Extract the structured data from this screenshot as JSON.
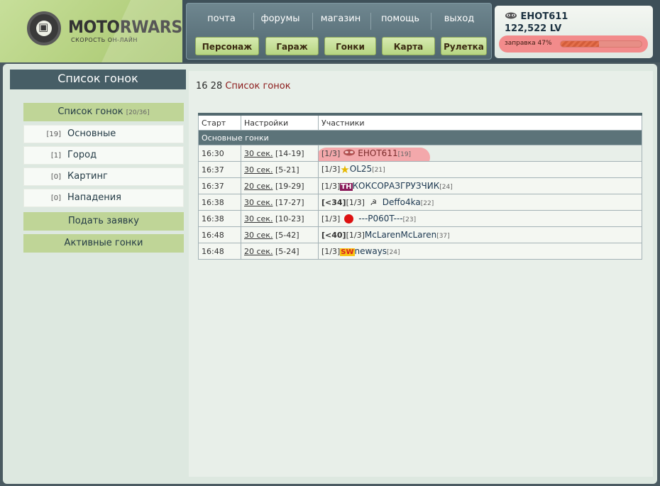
{
  "brand": {
    "title": "MOTORWARS.RU",
    "subtitle": "СКОРОСТЬ ОН-ЛАЙН"
  },
  "nav": {
    "top": [
      "почта",
      "форумы",
      "магазин",
      "помощь",
      "выход"
    ],
    "buttons": [
      "Персонаж",
      "Гараж",
      "Гонки",
      "Карта",
      "Рулетка"
    ]
  },
  "user": {
    "name": "ЕНОТ611",
    "money": "122,522 LV",
    "fuel_label": "заправка 47%",
    "fuel_percent": 47
  },
  "sidebar": {
    "title": "Список гонок",
    "list_label": "Список гонок",
    "list_count": "[20/36]",
    "items": [
      {
        "count": "[19]",
        "label": "Основные"
      },
      {
        "count": "[1]",
        "label": "Город"
      },
      {
        "count": "[0]",
        "label": "Картинг"
      },
      {
        "count": "[0]",
        "label": "Нападения"
      }
    ],
    "apply": "Подать заявку",
    "active": "Активные гонки"
  },
  "page": {
    "time": "16 28",
    "title": "Список гонок"
  },
  "table": {
    "headers": [
      "Старт",
      "Настройки",
      "Участники"
    ],
    "group": "Основные гонки",
    "rows": [
      {
        "start": "16:30",
        "setting": "30 сек.",
        "range": "[14-19]",
        "pre": "",
        "slots": "[1/3]",
        "icon": "raccoon",
        "name": "ЕНОТ611",
        "level": "[19]"
      },
      {
        "start": "16:37",
        "setting": "30 сек.",
        "range": "[5-21]",
        "pre": "",
        "slots": "[1/3]",
        "icon": "star",
        "name": "OL25",
        "level": "[21]"
      },
      {
        "start": "16:37",
        "setting": "20 сек.",
        "range": "[19-29]",
        "pre": "",
        "slots": "[1/3]",
        "icon": "tn-badge",
        "name": "КОКСОРАЗГРУЗЧИК",
        "level": "[24]"
      },
      {
        "start": "16:38",
        "setting": "30 сек.",
        "range": "[17-27]",
        "pre": "[<34]",
        "slots": "[1/3]",
        "icon": "hammer-sickle",
        "name": "Deffo4ka",
        "level": "[22]"
      },
      {
        "start": "16:38",
        "setting": "30 сек.",
        "range": "[10-23]",
        "pre": "",
        "slots": "[1/3]",
        "icon": "red-circle",
        "name": "---P060T---",
        "level": "[23]"
      },
      {
        "start": "16:48",
        "setting": "30 сек.",
        "range": "[5-42]",
        "pre": "[<40]",
        "slots": "[1/3]",
        "icon": "",
        "name": "McLarenMcLaren",
        "level": "[37]"
      },
      {
        "start": "16:48",
        "setting": "20 сек.",
        "range": "[5-24]",
        "pre": "",
        "slots": "[1/3]",
        "icon": "sw-badge",
        "name": "neways",
        "level": "[24]"
      }
    ]
  }
}
